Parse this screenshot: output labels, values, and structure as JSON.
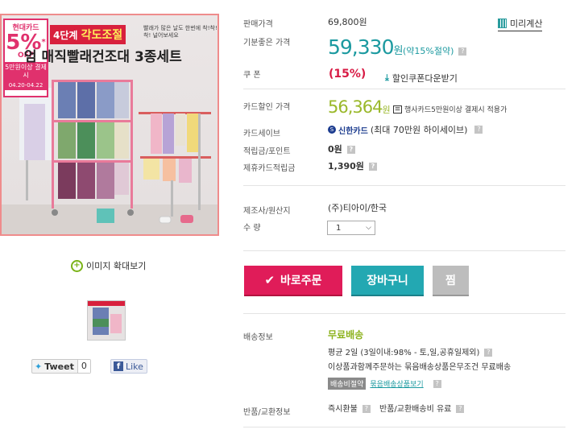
{
  "product_image": {
    "bank": "현대카드",
    "discount_pct": "5%",
    "discount_star": "*",
    "off": "OFF",
    "condition": "5만원이상 결제시",
    "period": "04.20-04.22",
    "headline_prefix": "4단계",
    "headline_highlight": "각도조절",
    "headline_sub": "빨래가 많은 날도 한번에 착!착!착! 널어보세요",
    "headline_main": "엄 매직빨래건조대 3종세트"
  },
  "left": {
    "zoom_label": "이미지 확대보기",
    "tweet_label": "Tweet",
    "tweet_count": "0",
    "like_label": "Like"
  },
  "info": {
    "sale_price_label": "판매가격",
    "sale_price": "69,800원",
    "calc_label": "미리계산",
    "good_price_label": "기분좋은 가격",
    "good_price": "59,330",
    "good_price_won": "원",
    "good_price_note": "(약15%절약)",
    "coupon_label": "쿠 폰",
    "coupon_pct": "(15%)",
    "coupon_download": "할인쿠폰다운받기",
    "card_price_label": "카드할인 가격",
    "card_price": "56,364",
    "card_price_won": "원",
    "card_note": "행사카드5만원이상 결제시 적용가",
    "card_save_label": "카드세이브",
    "card_save_bank": "신한카드",
    "card_save_text": "(최대 70만원 하이세이브)",
    "points_label": "적립금/포인트",
    "points_value": "0원",
    "partner_points_label": "제휴카드적립금",
    "partner_points_value": "1,390원",
    "maker_label": "제조사/원산지",
    "maker_value": "(주)티아이/한국",
    "qty_label": "수 량",
    "qty_value": "1"
  },
  "buttons": {
    "order": "바로주문",
    "cart": "장바구니",
    "wish": "찜"
  },
  "shipping": {
    "label": "배송정보",
    "free": "무료배송",
    "avg": "평균 2일  (3일이내:98% - 토,일,공휴일제외)",
    "bundle_text": "이상품과함께주문하는 묶음배송상품은무조건 무료배송",
    "bundle_tag": "배송비절약",
    "bundle_link": "묶음배송상품보기",
    "return_label": "반품/교환정보",
    "return_value": "즉시환불",
    "return_fee": "반품/교환배송비 유료"
  },
  "colors": {
    "accent_pink": "#e01c59",
    "accent_teal": "#23a8b2",
    "price_teal": "#1c9aa0",
    "card_price_green": "#9ab82a"
  }
}
